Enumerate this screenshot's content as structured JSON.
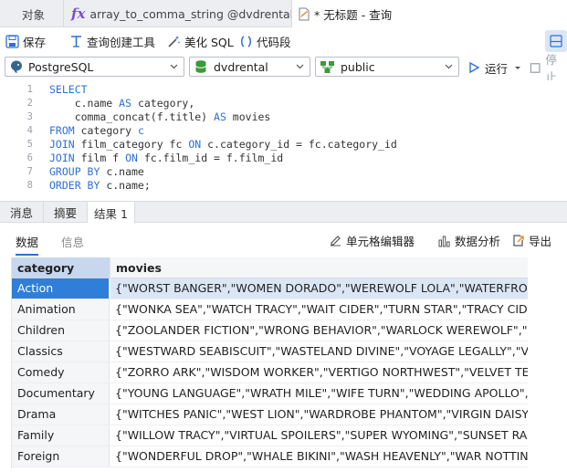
{
  "tabs": [
    {
      "label": "对象"
    },
    {
      "label": "array_to_comma_string @dvdrental.pub..."
    },
    {
      "label": "* 无标题 - 查询"
    }
  ],
  "toolbar": {
    "save": "保存",
    "query_builder": "查询创建工具",
    "beautify": "美化 SQL",
    "snippet": "代码段"
  },
  "selectors": {
    "connection": "PostgreSQL",
    "database": "dvdrental",
    "schema": "public",
    "run": "运行",
    "stop": "停止"
  },
  "editor": {
    "lines": [
      {
        "n": "1",
        "parts": [
          {
            "t": "SELECT",
            "k": true
          }
        ]
      },
      {
        "n": "2",
        "parts": [
          {
            "t": "    c.name ",
            "k": false
          },
          {
            "t": "AS",
            "k": true
          },
          {
            "t": " category,",
            "k": false
          }
        ]
      },
      {
        "n": "3",
        "parts": [
          {
            "t": "    comma_concat(f.title) ",
            "k": false
          },
          {
            "t": "AS",
            "k": true
          },
          {
            "t": " movies",
            "k": false
          }
        ]
      },
      {
        "n": "4",
        "parts": [
          {
            "t": "FROM",
            "k": true
          },
          {
            "t": " category ",
            "k": false
          },
          {
            "t": "c",
            "k": true
          }
        ]
      },
      {
        "n": "5",
        "parts": [
          {
            "t": "JOIN",
            "k": true
          },
          {
            "t": " film_category fc ",
            "k": false
          },
          {
            "t": "ON",
            "k": true
          },
          {
            "t": " c.category_id = fc.category_id",
            "k": false
          }
        ]
      },
      {
        "n": "6",
        "parts": [
          {
            "t": "JOIN",
            "k": true
          },
          {
            "t": " film f ",
            "k": false
          },
          {
            "t": "ON",
            "k": true
          },
          {
            "t": " fc.film_id = f.film_id",
            "k": false
          }
        ]
      },
      {
        "n": "7",
        "parts": [
          {
            "t": "GROUP BY",
            "k": true
          },
          {
            "t": " c.name",
            "k": false
          }
        ]
      },
      {
        "n": "8",
        "parts": [
          {
            "t": "ORDER BY",
            "k": true
          },
          {
            "t": " c.name;",
            "k": false
          }
        ]
      }
    ]
  },
  "message_tabs": [
    "消息",
    "摘要",
    "结果 1"
  ],
  "result_toolbar": {
    "data_tab": "数据",
    "info_tab": "信息",
    "cell_editor": "单元格编辑器",
    "data_analysis": "数据分析",
    "export": "导出"
  },
  "grid": {
    "columns": [
      "category",
      "movies"
    ],
    "rows": [
      [
        "Action",
        "{\"WORST BANGER\",\"WOMEN DORADO\",\"WEREWOLF LOLA\",\"WATERFRONT D"
      ],
      [
        "Animation",
        "{\"WONKA SEA\",\"WATCH TRACY\",\"WAIT CIDER\",\"TURN STAR\",\"TRACY CIDER\",\"T"
      ],
      [
        "Children",
        "{\"ZOOLANDER FICTION\",\"WRONG BEHAVIOR\",\"WARLOCK WEREWOLF\",\"WALL"
      ],
      [
        "Classics",
        "{\"WESTWARD SEABISCUIT\",\"WASTELAND DIVINE\",\"VOYAGE LEGALLY\",\"VOLUM"
      ],
      [
        "Comedy",
        "{\"ZORRO ARK\",\"WISDOM WORKER\",\"VERTIGO NORTHWEST\",\"VELVET TERMIN"
      ],
      [
        "Documentary",
        "{\"YOUNG LANGUAGE\",\"WRATH MILE\",\"WIFE TURN\",\"WEDDING APOLLO\",\"WAF"
      ],
      [
        "Drama",
        "{\"WITCHES PANIC\",\"WEST LION\",\"WARDROBE PHANTOM\",\"VIRGIN DAISY\",\"VIE"
      ],
      [
        "Family",
        "{\"WILLOW TRACY\",\"VIRTUAL SPOILERS\",\"SUPER WYOMING\",\"SUNSET RACER\",\""
      ],
      [
        "Foreign",
        "{\"WONDERFUL DROP\",\"WHALE BIKINI\",\"WASH HEAVENLY\",\"WAR NOTTING\",\"V"
      ]
    ]
  },
  "colors": {
    "accent": "#2f7fd9",
    "keyword": "#2f6fd6",
    "selected_row_bg": "#dbe6f5"
  }
}
